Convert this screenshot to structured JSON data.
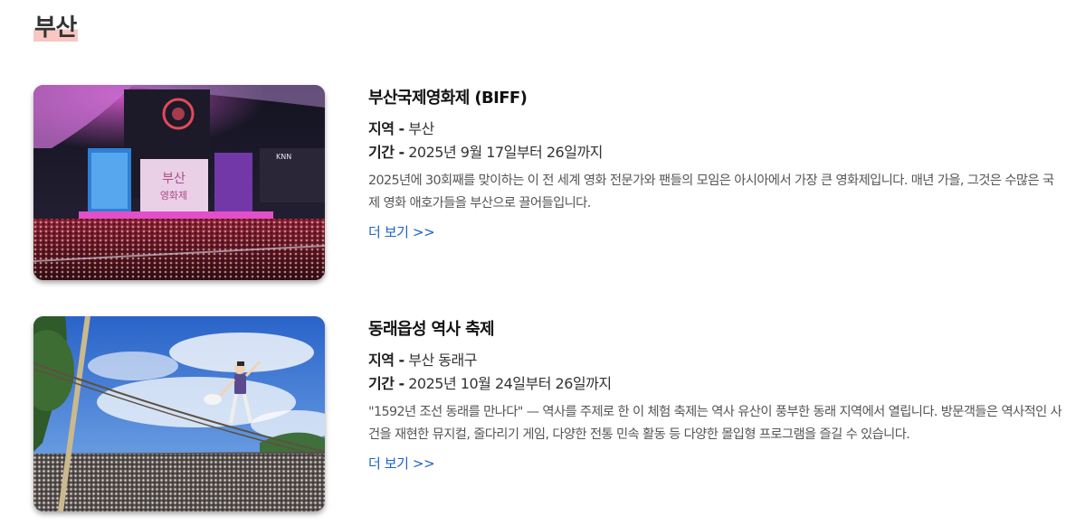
{
  "region": {
    "title": "부산"
  },
  "festivals": [
    {
      "title": "부산국제영화제 (BIFF)",
      "region_label": "지역 -",
      "region_value": "부산",
      "period_label": "기간 -",
      "period_value": "2025년 9월 17일부터 26일까지",
      "description": "2025년에 30회째를 맞이하는 이 전 세계 영화 전문가와 팬들의 모임은 아시아에서 가장 큰 영화제입니다. 매년 가을, 그것은 수많은 국제 영화 애호가들을 부산으로 끌어들입니다.",
      "more_label": "더 보기 >>",
      "image_alt": "부산국제영화제 야외무대 전경"
    },
    {
      "title": "동래읍성 역사 축제",
      "region_label": "지역 -",
      "region_value": "부산 동래구",
      "period_label": "기간 -",
      "period_value": "2025년 10월 24일부터 26일까지",
      "description": "\"1592년 조선 동래를 만나다\" — 역사를 주제로 한 이 체험 축제는 역사 유산이 풍부한 동래 지역에서 열립니다. 방문객들은 역사적인 사건을 재현한 뮤지컬, 줄다리기 게임, 다양한 전통 민속 활동 등 다양한 몰입형 프로그램을 즐길 수 있습니다.",
      "more_label": "더 보기 >>",
      "image_alt": "줄타기 공연"
    }
  ]
}
